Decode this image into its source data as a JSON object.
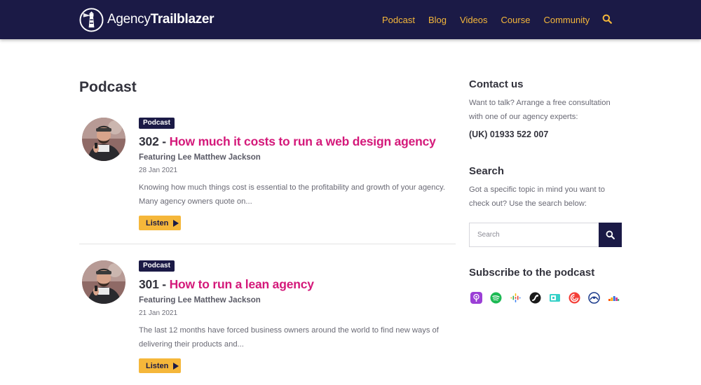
{
  "header": {
    "logo_light": "Agency",
    "logo_bold": "Trailblazer",
    "nav": [
      "Podcast",
      "Blog",
      "Videos",
      "Course",
      "Community"
    ],
    "icons": {
      "search": "search-icon",
      "logo": "lighthouse-icon"
    },
    "colors": {
      "bar": "#1b1a46",
      "link": "#f5b73a"
    }
  },
  "main": {
    "title": "Podcast",
    "posts": [
      {
        "tag": "Podcast",
        "number": "302 -",
        "name": "How much it costs to run a web design agency",
        "featuring": "Featuring Lee Matthew Jackson",
        "date": "28 Jan 2021",
        "excerpt": "Knowing how much things cost is essential to the profitability and growth of your agency. Many agency owners quote on...",
        "button": "Listen"
      },
      {
        "tag": "Podcast",
        "number": "301 -",
        "name": "How to run a lean agency",
        "featuring": "Featuring Lee Matthew Jackson",
        "date": "21 Jan 2021",
        "excerpt": "The last 12 months have forced business owners around the world to find new ways of delivering their products and...",
        "button": "Listen"
      }
    ],
    "colors": {
      "accent": "#d4197a",
      "button": "#f5b73a"
    }
  },
  "sidebar": {
    "contact": {
      "title": "Contact us",
      "text": "Want to talk? Arrange a free consultation with one of our agency experts:",
      "phone": "(UK) 01933 522 007"
    },
    "search": {
      "title": "Search",
      "text": "Got a specific topic in mind you want to check out? Use the search below:",
      "placeholder": "Search"
    },
    "subscribe": {
      "title": "Subscribe to the podcast",
      "platforms": [
        "apple-podcasts-icon",
        "spotify-icon",
        "google-podcasts-icon",
        "stitcher-icon",
        "tunein-icon",
        "pocket-casts-icon",
        "overcast-icon",
        "deezer-icon"
      ]
    }
  }
}
